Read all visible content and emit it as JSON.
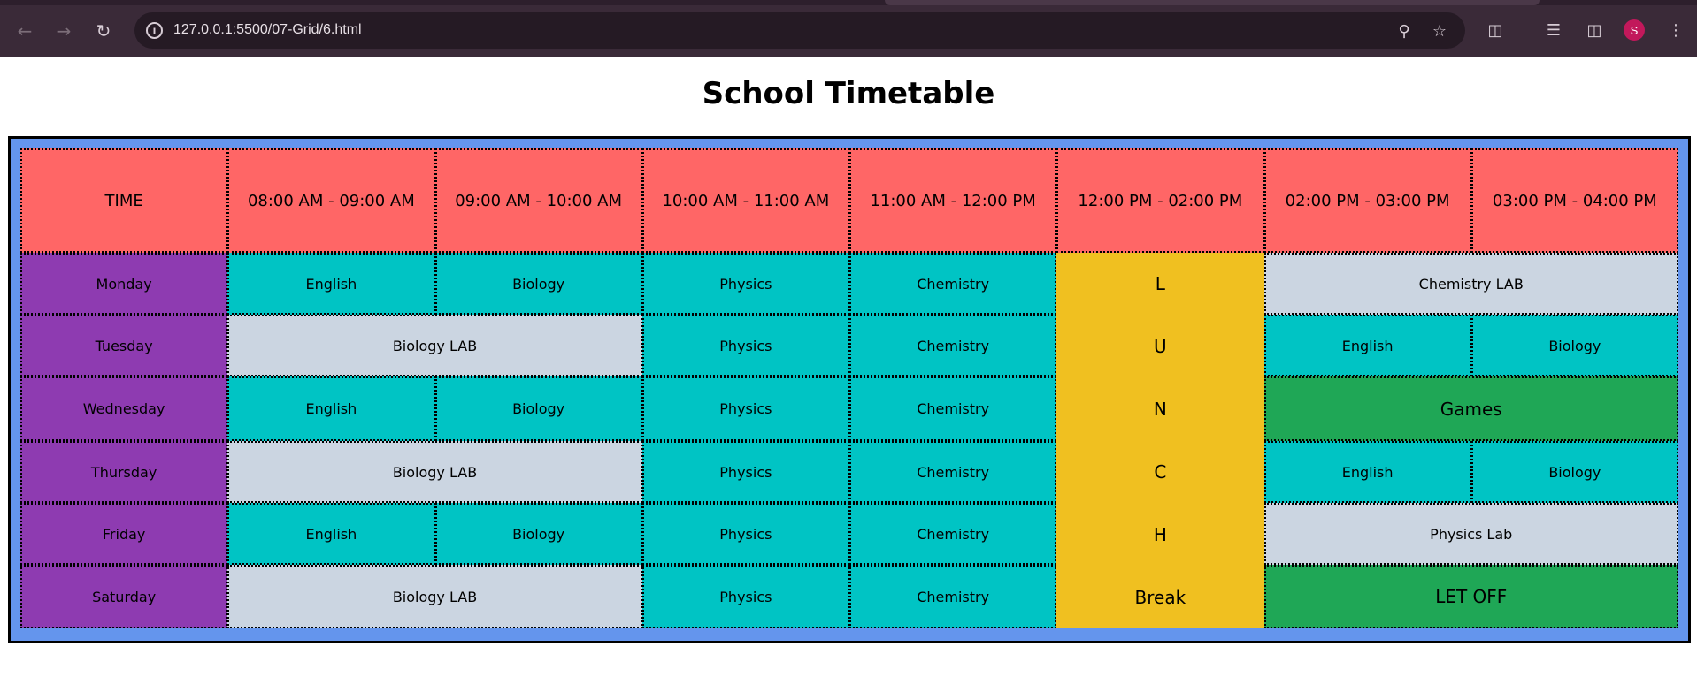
{
  "browser": {
    "url": "127.0.0.1:5500/07-Grid/6.html",
    "back_icon": "arrow-left-icon",
    "forward_icon": "arrow-right-icon",
    "reload_icon": "reload-icon",
    "profile_initial": "S",
    "profile_color": "#c2185b"
  },
  "page": {
    "title": "School Timetable"
  },
  "timetable": {
    "headers": [
      "TIME",
      "08:00 AM - 09:00 AM",
      "09:00 AM - 10:00 AM",
      "10:00 AM - 11:00 AM",
      "11:00 AM - 12:00 PM",
      "12:00 PM - 02:00 PM",
      "02:00 PM - 03:00 PM",
      "03:00 PM - 04:00 PM"
    ],
    "days": [
      "Monday",
      "Tuesday",
      "Wednesday",
      "Thursday",
      "Friday",
      "Saturday"
    ],
    "lunch_letters": [
      "L",
      "U",
      "N",
      "C",
      "H",
      "Break"
    ],
    "monday": {
      "p1": "English",
      "p2": "Biology",
      "p3": "Physics",
      "p4": "Chemistry",
      "p6": "Chemistry LAB"
    },
    "tuesday": {
      "p12": "Biology LAB",
      "p3": "Physics",
      "p4": "Chemistry",
      "p6": "English",
      "p7": "Biology"
    },
    "wednesday": {
      "p1": "English",
      "p2": "Biology",
      "p3": "Physics",
      "p4": "Chemistry",
      "p6": "Games"
    },
    "thursday": {
      "p12": "Biology LAB",
      "p3": "Physics",
      "p4": "Chemistry",
      "p6": "English",
      "p7": "Biology"
    },
    "friday": {
      "p1": "English",
      "p2": "Biology",
      "p3": "Physics",
      "p4": "Chemistry",
      "p6": "Physics Lab"
    },
    "saturday": {
      "p12": "Biology LAB",
      "p3": "Physics",
      "p4": "Chemistry",
      "p6": "LET OFF"
    },
    "colors": {
      "header": "#ff6666",
      "day": "#8e3bb1",
      "subject": "#00c4c4",
      "lab": "#cbd5e1",
      "games": "#1fa756",
      "lunch": "#f0c020",
      "frame": "#6495ed"
    }
  }
}
